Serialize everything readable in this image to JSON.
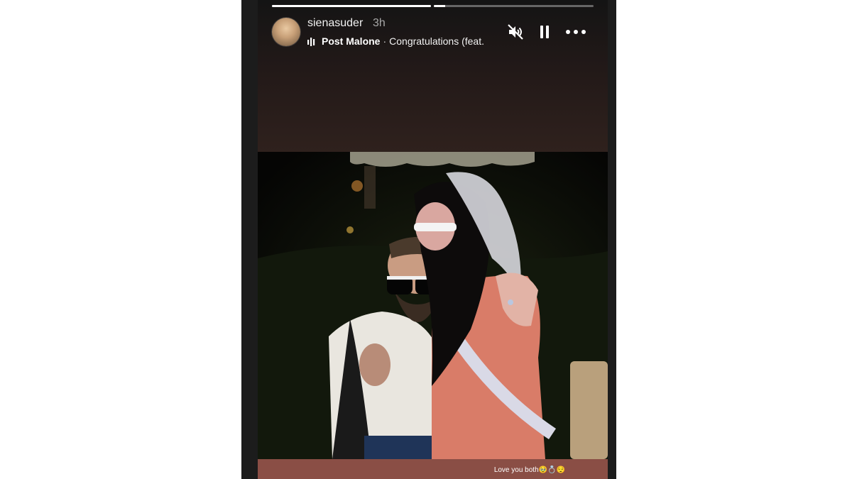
{
  "story": {
    "username": "sienasuder",
    "time_ago": "3h",
    "progress": [
      1.0,
      0.07
    ],
    "music": {
      "artist": "Post Malone",
      "separator": "·",
      "song": "Congratulations (feat."
    },
    "controls": {
      "mute_icon": "speaker-muted-icon",
      "pause_icon": "pause-icon",
      "more_icon": "more-horizontal-icon"
    },
    "caption": "Love you both🥹💍😌"
  },
  "colors": {
    "frame": "#1c1c1c",
    "caption_bar": "#8a4e45",
    "text": "#ffffff",
    "muted_text": "#a8a8a8"
  }
}
